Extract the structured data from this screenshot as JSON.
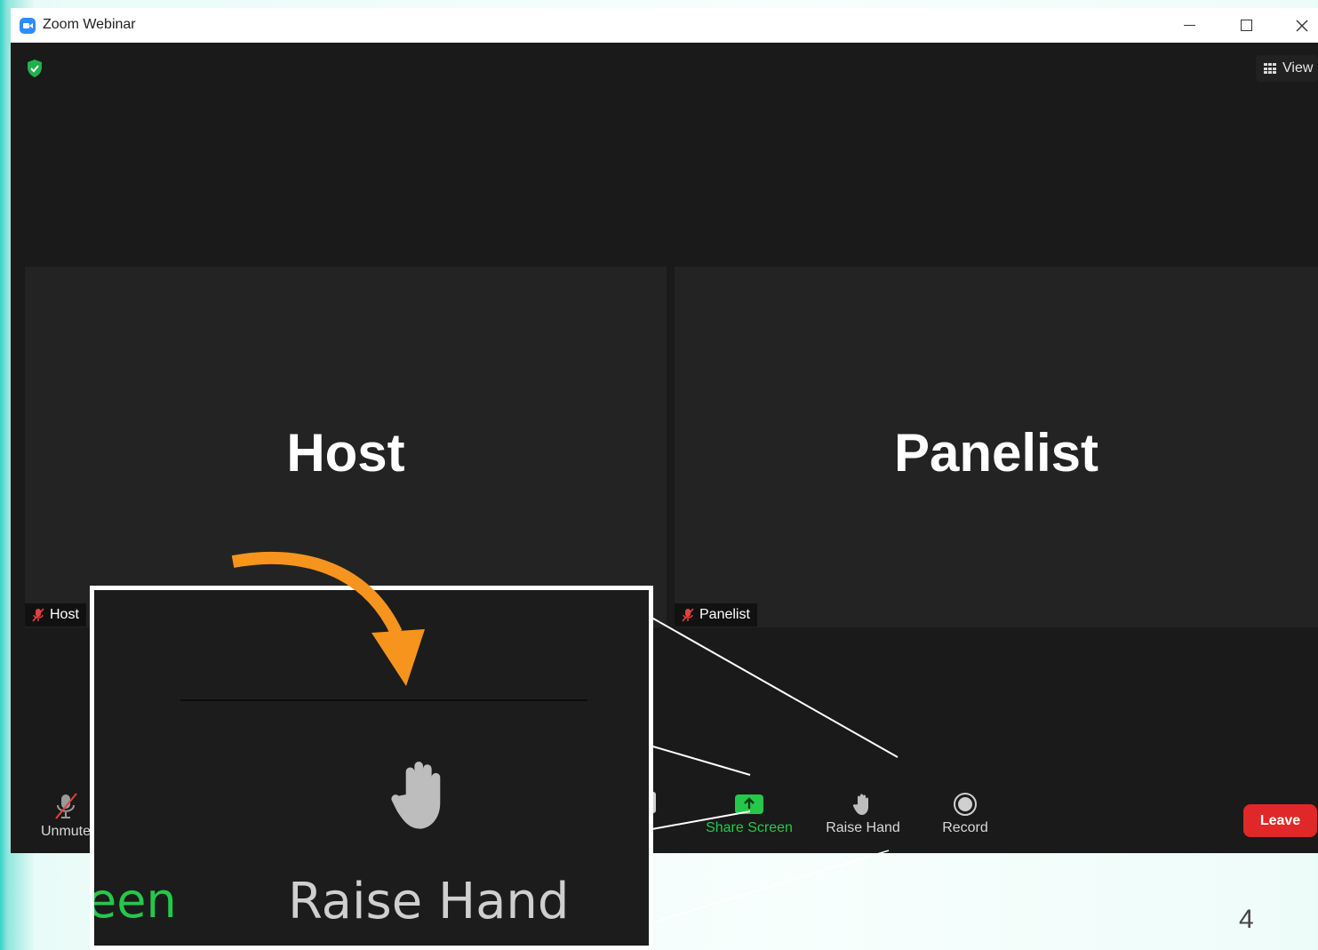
{
  "window": {
    "title": "Zoom Webinar"
  },
  "top_right": {
    "view_label": "View"
  },
  "participants": {
    "host": {
      "tile_name": "Host",
      "tag": "Host"
    },
    "panelist": {
      "tile_name": "Panelist",
      "tag": "Panelist"
    }
  },
  "toolbar": {
    "unmute_label": "Unmute",
    "chat_fragment": "t",
    "share_label": "Share Screen",
    "raise_hand_label": "Raise Hand",
    "record_label": "Record",
    "leave_label": "Leave"
  },
  "zoom_callout": {
    "green_fragment": "een",
    "label": "Raise Hand"
  },
  "slide": {
    "page_number": "4"
  },
  "colors": {
    "accent_green": "#25c84a",
    "leave_red": "#e02828",
    "arrow_orange": "#f7941d",
    "muted_red": "#e54040"
  }
}
